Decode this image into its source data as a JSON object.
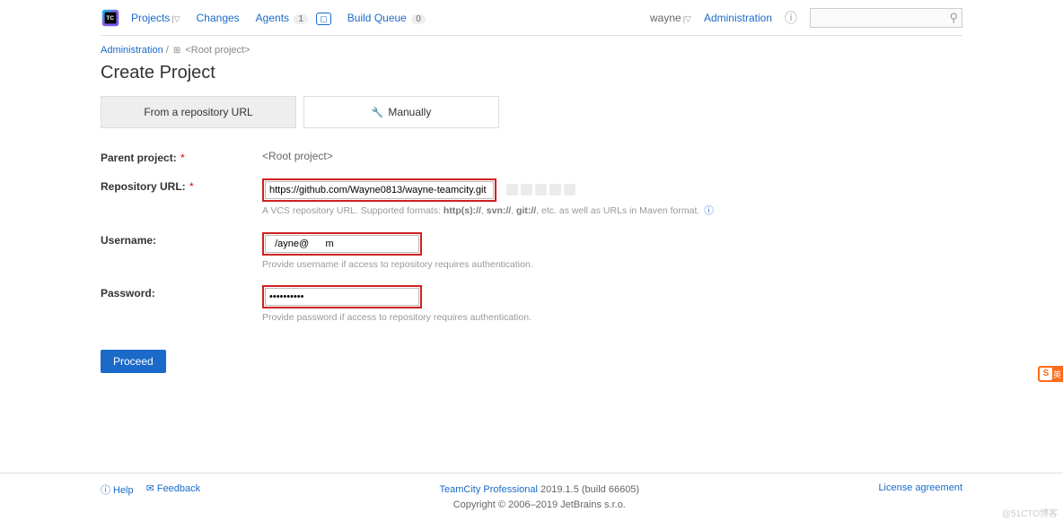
{
  "header": {
    "nav": {
      "projects": "Projects",
      "changes": "Changes",
      "agents": "Agents",
      "agents_count": "1",
      "build_queue": "Build Queue",
      "build_queue_count": "0"
    },
    "user": "wayne",
    "admin": "Administration"
  },
  "breadcrumb": {
    "admin": "Administration",
    "root": "<Root project>"
  },
  "page_title": "Create Project",
  "tabs": {
    "repo": "From a repository URL",
    "manual": "Manually"
  },
  "form": {
    "parent_label": "Parent project:",
    "parent_value": "<Root project>",
    "url_label": "Repository URL:",
    "url_value": "https://github.com/Wayne0813/wayne-teamcity.git",
    "url_hint_prefix": "A VCS repository URL. Supported formats: ",
    "url_hint_fmt1": "http(s)://",
    "url_hint_fmt2": "svn://",
    "url_hint_fmt3": "git://",
    "url_hint_suffix": ", etc. as well as URLs in Maven format.",
    "username_label": "Username:",
    "username_value": "  /ayne@      m",
    "username_hint": "Provide username if access to repository requires authentication.",
    "password_label": "Password:",
    "password_value": "••••••••••",
    "password_hint": "Provide password if access to repository requires authentication.",
    "proceed": "Proceed"
  },
  "footer": {
    "help": "Help",
    "feedback": "Feedback",
    "product": "TeamCity Professional",
    "version": "2019.1.5 (build 66605)",
    "copyright": "Copyright © 2006–2019 JetBrains s.r.o.",
    "license": "License agreement"
  },
  "watermark": "@51CTO博客",
  "side": {
    "s": "S",
    "txt": "英"
  }
}
